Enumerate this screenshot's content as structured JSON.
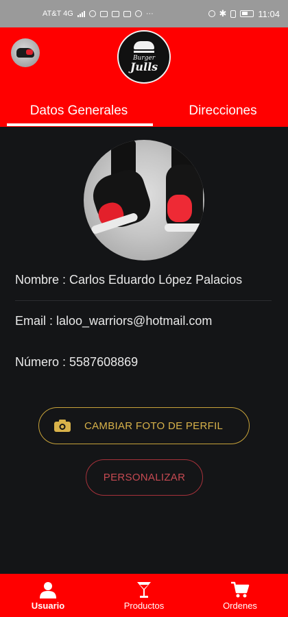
{
  "status_bar": {
    "carrier": "AT&T 4G",
    "time": "11:04"
  },
  "header": {
    "logo_line1": "Burger",
    "logo_line2": "Julls",
    "tabs": [
      {
        "label": "Datos Generales",
        "active": true
      },
      {
        "label": "Direcciones",
        "active": false
      }
    ]
  },
  "profile": {
    "nombre": "Nombre : Carlos Eduardo López Palacios",
    "email": "Email : laloo_warriors@hotmail.com",
    "numero": "Número : 5587608869"
  },
  "buttons": {
    "change_photo": "CAMBIAR FOTO DE PERFIL",
    "customize": "PERSONALIZAR"
  },
  "bottom_nav": [
    {
      "label": "Usuario",
      "icon": "user-icon",
      "active": true
    },
    {
      "label": "Productos",
      "icon": "drink-icon",
      "active": false
    },
    {
      "label": "Ordenes",
      "icon": "cart-icon",
      "active": false
    }
  ],
  "colors": {
    "primary_red": "#ff0000",
    "background": "#141517",
    "gold_accent": "#d8b24a",
    "customize_red": "#c64a52"
  }
}
